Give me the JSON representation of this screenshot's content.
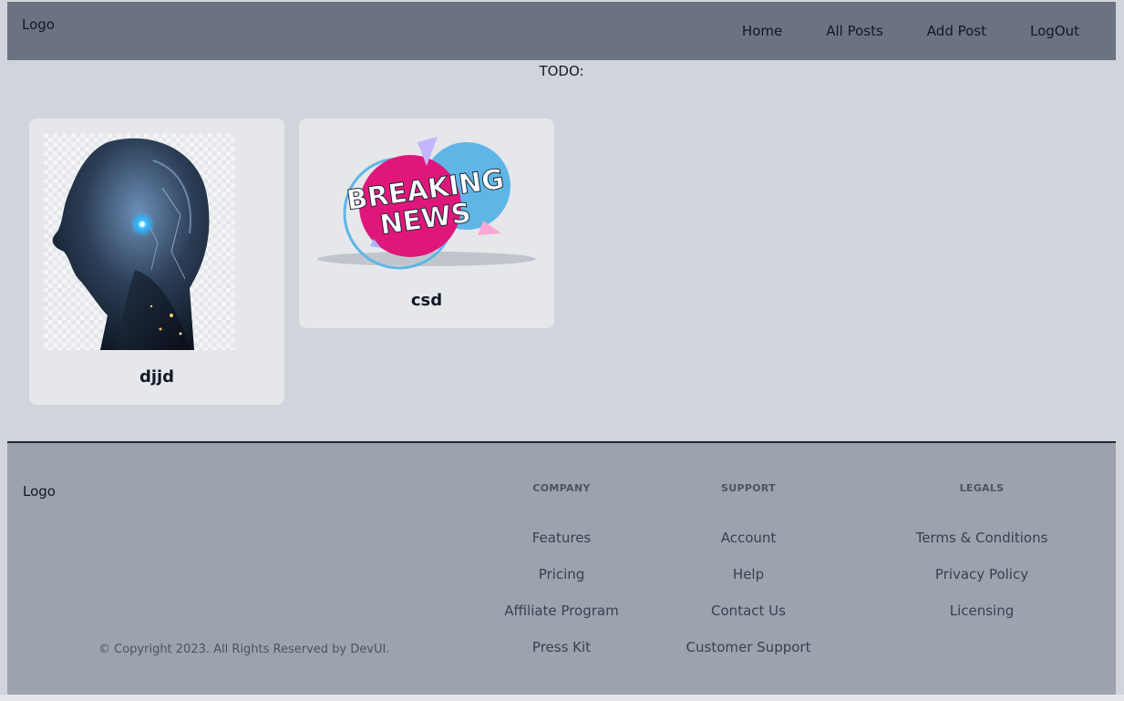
{
  "header": {
    "logo": "Logo",
    "nav": [
      "Home",
      "All Posts",
      "Add Post",
      "LogOut"
    ]
  },
  "todo": "TODO:",
  "posts": [
    {
      "title": "djjd",
      "image": "ai-robot-head-image"
    },
    {
      "title": "csd",
      "image": "breaking-news-image",
      "image_text": [
        "BREAKING",
        "NEWS"
      ]
    }
  ],
  "footer": {
    "logo": "Logo",
    "copyright": "© Copyright 2023. All Rights Reserved by DevUI.",
    "columns": [
      {
        "heading": "COMPANY",
        "links": [
          "Features",
          "Pricing",
          "Affiliate Program",
          "Press Kit"
        ]
      },
      {
        "heading": "SUPPORT",
        "links": [
          "Account",
          "Help",
          "Contact Us",
          "Customer Support"
        ]
      },
      {
        "heading": "LEGALS",
        "links": [
          "Terms & Conditions",
          "Privacy Policy",
          "Licensing"
        ]
      }
    ]
  },
  "colors": {
    "header_bg": "#6b7280",
    "page_bg": "#d1d5db",
    "card_bg": "#e5e7eb",
    "footer_bg": "#9ca3af",
    "news_pink": "#e0177a",
    "news_blue": "#5fb6e6"
  }
}
